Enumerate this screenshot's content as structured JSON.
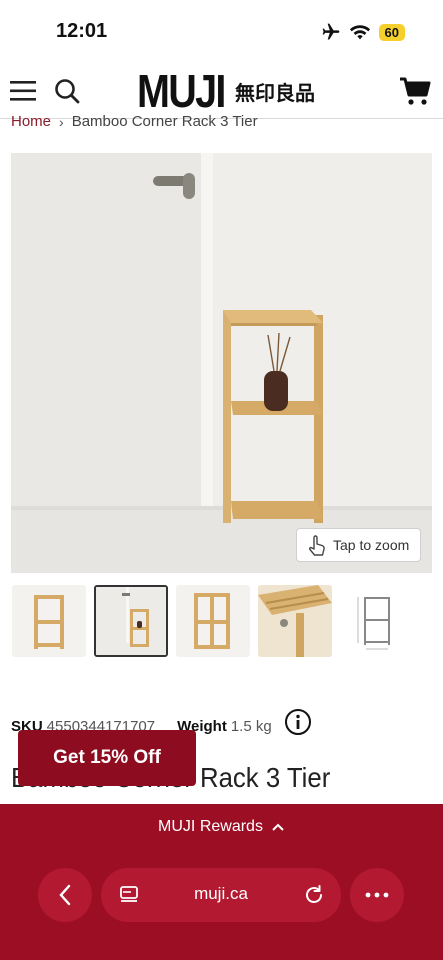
{
  "status_bar": {
    "time": "12:01",
    "battery": "60",
    "icons": [
      "airplane-icon",
      "wifi-icon",
      "battery-icon"
    ]
  },
  "header": {
    "logo_latin": "MUJI",
    "logo_kanji": "無印良品",
    "icons": [
      "menu-icon",
      "search-icon",
      "cart-icon"
    ]
  },
  "breadcrumb": {
    "home": "Home",
    "separator": "›",
    "current": "Bamboo Corner Rack 3 Tier"
  },
  "product": {
    "zoom_label": "Tap to zoom",
    "thumbnail_count": 5,
    "active_thumbnail": 2,
    "sku_label": "SKU",
    "sku_value": "4550344171707",
    "weight_label": "Weight",
    "weight_value": "1.5 kg",
    "title": "Bamboo Corner Rack 3 Tier"
  },
  "promo": {
    "label": "Get 15% Off"
  },
  "browser": {
    "rewards_label": "MUJI Rewards",
    "url": "muji.ca"
  },
  "colors": {
    "brand_red": "#9c0e24",
    "promo_red": "#8e0c1f",
    "link_red": "#8a1c2c",
    "battery_yellow": "#f5d02c"
  }
}
